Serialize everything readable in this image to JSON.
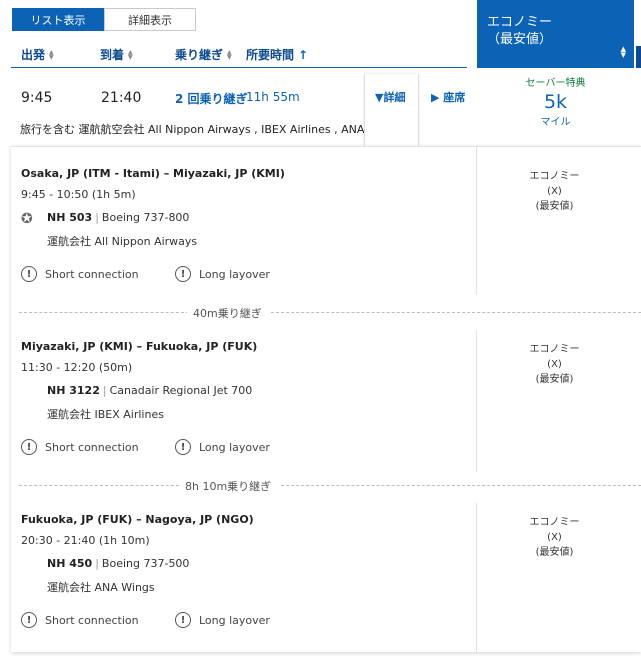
{
  "view_toggle": {
    "list_label": "リスト表示",
    "detail_label": "詳細表示"
  },
  "sort_headers": {
    "departure": "出発",
    "arrival": "到着",
    "connections": "乗り継ぎ",
    "duration": "所要時間"
  },
  "fare_column": {
    "title_line1": "エコノミー",
    "title_line2": "（最安値）"
  },
  "summary": {
    "depart": "9:45",
    "arrive": "21:40",
    "stops": "2 回乗り継ぎ",
    "duration": "11h 55m",
    "details_link": "詳細",
    "seats_link": "座席",
    "operated_by": "旅行を含む 運航航空会社 All Nippon Airways , IBEX Airlines , ANA Wings",
    "award_type": "セーバー特典",
    "miles": "5k",
    "miles_unit": "マイル"
  },
  "segments": [
    {
      "route": "Osaka, JP (ITM - Itami) – Miyazaki, JP (KMI)",
      "times": "9:45 - 10:50 (1h 5m)",
      "flight_number": "NH 503",
      "aircraft": "Boeing 737-800",
      "operator": "運航会社 All Nippon Airways",
      "warn_short": "Short connection",
      "warn_long": "Long layover",
      "cabin_line1": "エコノミー",
      "cabin_line2": "(X)",
      "cabin_line3": "(最安値)"
    },
    {
      "route": "Miyazaki, JP (KMI) – Fukuoka, JP (FUK)",
      "times": "11:30 - 12:20 (50m)",
      "flight_number": "NH 3122",
      "aircraft": "Canadair Regional Jet 700",
      "operator": "運航会社 IBEX Airlines",
      "warn_short": "Short connection",
      "warn_long": "Long layover",
      "cabin_line1": "エコノミー",
      "cabin_line2": "(X)",
      "cabin_line3": "(最安値)"
    },
    {
      "route": "Fukuoka, JP (FUK) – Nagoya, JP (NGO)",
      "times": "20:30 - 21:40 (1h 10m)",
      "flight_number": "NH 450",
      "aircraft": "Boeing 737-500",
      "operator": "運航会社 ANA Wings",
      "warn_short": "Short connection",
      "warn_long": "Long layover",
      "cabin_line1": "エコノミー",
      "cabin_line2": "(X)",
      "cabin_line3": "(最安値)"
    }
  ],
  "layovers": [
    "40m乗り継ぎ",
    "8h 10m乗り継ぎ"
  ]
}
